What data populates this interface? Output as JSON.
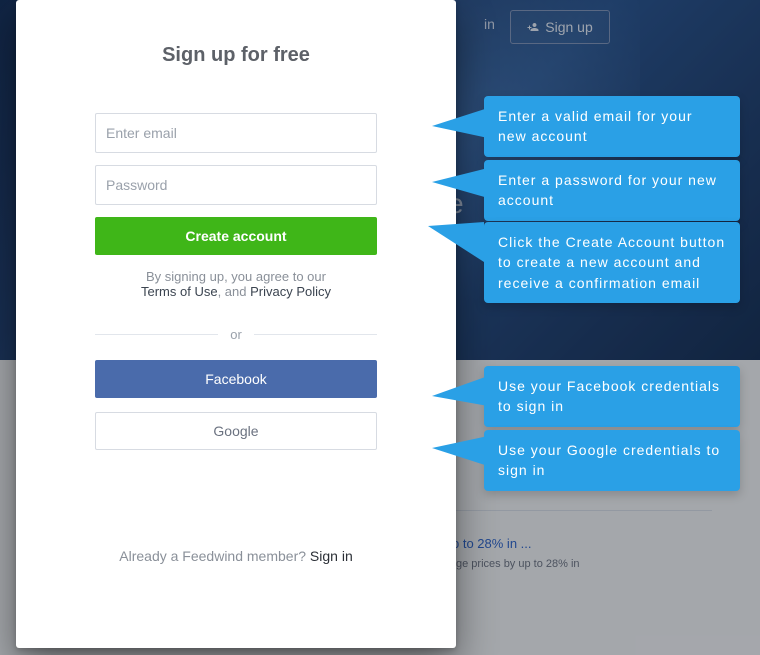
{
  "header": {
    "in_text": "in",
    "sign_up_label": "Sign up"
  },
  "background": {
    "letter": "e",
    "snippet_title": "p to 28% in ...",
    "snippet_sub": "ge prices by up to 28% in"
  },
  "modal": {
    "title": "Sign up for free",
    "email_placeholder": "Enter email",
    "password_placeholder": "Password",
    "create_label": "Create account",
    "agree_prefix": "By signing up, you agree to our",
    "terms_label": "Terms of Use",
    "agree_sep": ", and ",
    "privacy_label": "Privacy Policy",
    "or_label": "or",
    "facebook_label": "Facebook",
    "google_label": "Google",
    "footer_prefix": "Already a Feedwind member? ",
    "signin_label": "Sign in"
  },
  "callouts": {
    "c1": "Enter a valid email for your new account",
    "c2": "Enter a password for your new account",
    "c3": "Click the Create Account button to create a new account and receive a confirmation email",
    "c4": "Use your Facebook credentials to sign in",
    "c5": "Use your Google credentials to sign in"
  }
}
